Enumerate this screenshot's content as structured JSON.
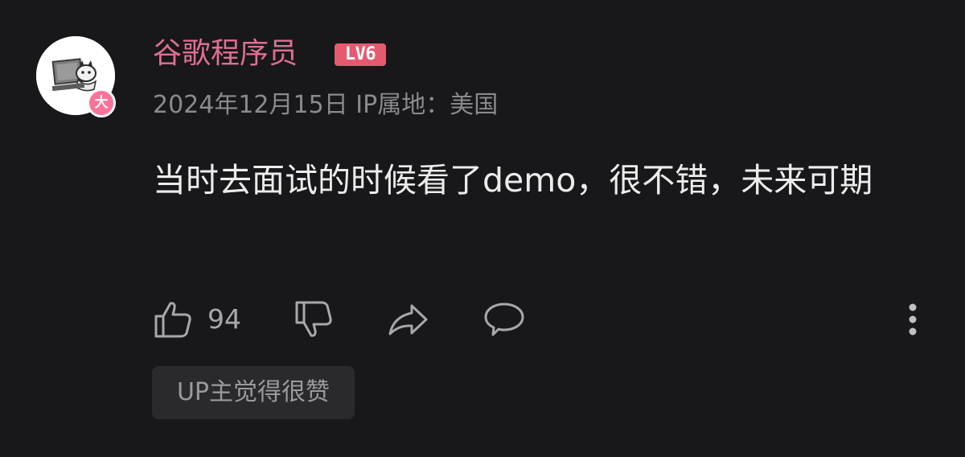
{
  "comment": {
    "username": "谷歌程序员",
    "level_badge": "LV6",
    "avatar_badge": "大",
    "date": "2024年12月15日",
    "ip_location": "IP属地：美国",
    "text": "当时去面试的时候看了demo，很不错，未来可期",
    "likes": "94",
    "up_badge": "UP主觉得很赞"
  },
  "colors": {
    "background": "#18181b",
    "username": "#e06e8f",
    "level_badge": "#e65a6f",
    "avatar_badge": "#fb7299",
    "text": "#ececec",
    "meta": "#8a8a8e",
    "icon": "#a8a8ac",
    "up_badge_bg": "#2a2a2e"
  },
  "icons": [
    "thumbs-up-icon",
    "thumbs-down-icon",
    "share-icon",
    "reply-bubble-icon",
    "more-vertical-icon"
  ]
}
